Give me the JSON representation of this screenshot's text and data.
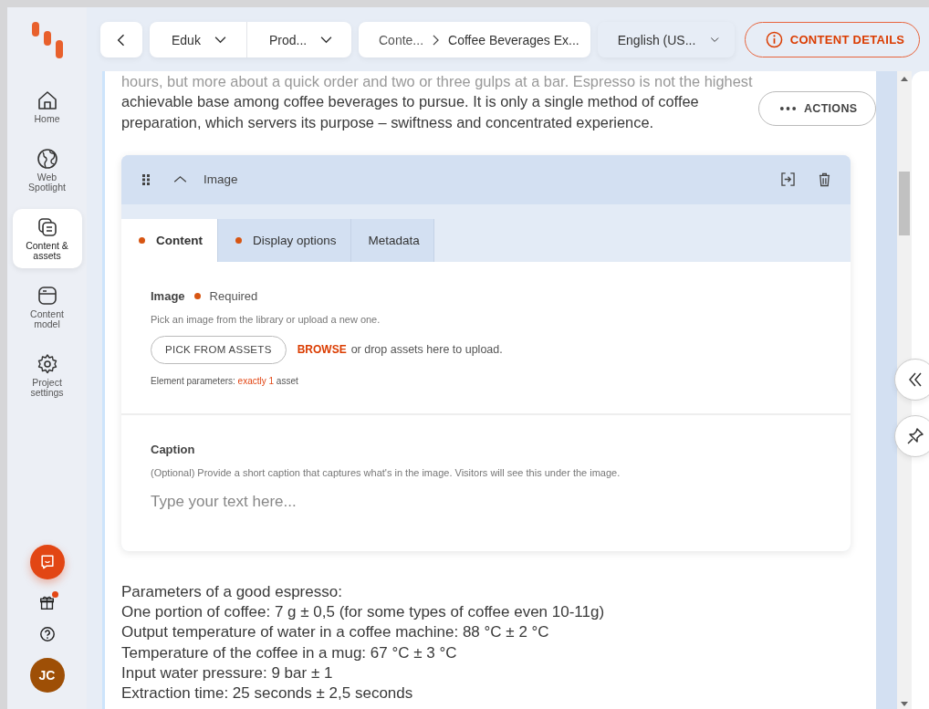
{
  "nav": [
    {
      "kind": "home",
      "label": "Home",
      "selected": false
    },
    {
      "kind": "globe",
      "label": "Web Spotlight",
      "selected": false
    },
    {
      "kind": "content",
      "label": "Content & assets",
      "selected": true
    },
    {
      "kind": "model",
      "label": "Content model",
      "selected": false
    },
    {
      "kind": "settings",
      "label": "Project settings",
      "selected": false
    }
  ],
  "footer": {
    "gift_notification": true,
    "avatar": "JC"
  },
  "topbar": {
    "project": "Eduk",
    "environment": "Prod...",
    "breadcrumb": [
      "Conte...",
      "Coffee Beverages Ex..."
    ],
    "language": "English (US...",
    "details_button": "CONTENT DETAILS"
  },
  "editor": {
    "paragraph_lines": [
      "hours, but more about a quick order and two or three gulps at a bar. Espresso is not the highest",
      "achievable base among coffee beverages to pursue. It is only a single method of coffee",
      "preparation, which servers its purpose – swiftness and concentrated experience."
    ],
    "actions_button": "ACTIONS",
    "component": {
      "title": "Image",
      "expanded": true,
      "tabs": [
        {
          "label": "Content",
          "has_issue": true,
          "selected": true
        },
        {
          "label": "Display options",
          "has_issue": true,
          "selected": false
        },
        {
          "label": "Metadata",
          "has_issue": false,
          "selected": false
        }
      ],
      "image_element": {
        "label": "Image",
        "required": "Required",
        "hint": "Pick an image from the library or upload a new one.",
        "pick_button": "PICK FROM ASSETS",
        "browse_link": "BROWSE",
        "drop_text": "or drop assets here to upload.",
        "params_label": "Element parameters:",
        "params_value": "exactly 1",
        "params_unit": "asset"
      },
      "caption_element": {
        "label": "Caption",
        "hint": "(Optional) Provide a short caption that captures what's in the image. Visitors will see this under the image.",
        "placeholder": "Type your text here..."
      }
    },
    "parameter_lines": [
      "Parameters of a good espresso:",
      "One portion of coffee: 7 g ± 0,5 (for some types of coffee even 10-11g)",
      "Output temperature of water in a coffee machine: 88 °C ± 2 °C",
      "Temperature of the coffee in a mug: 67 °C ± 3 °C",
      "Input water pressure: 9 bar ± 1",
      "Extraction time: 25 seconds ± 2,5 seconds"
    ]
  }
}
